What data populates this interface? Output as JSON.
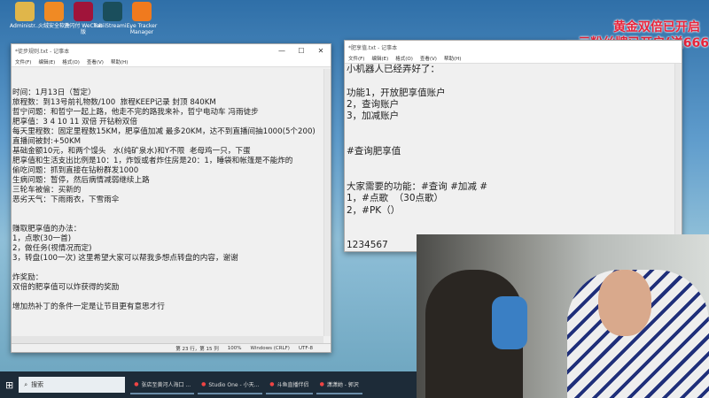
{
  "desktop_icons": [
    "Administr...",
    "火绒安全软件",
    "云闪付 WeChat版",
    "TobiiStreami...",
    "Eye Tracker Manager"
  ],
  "overlay": {
    "line1": "黄金双倍已开启",
    "line2": "一元粉丝牌已开启(送666"
  },
  "notepad1": {
    "title": "*徒步规则.txt - 记事本",
    "menu": [
      "文件(F)",
      "编辑(E)",
      "格式(O)",
      "查看(V)",
      "帮助(H)"
    ],
    "lines": [
      "",
      "",
      "时间：1月13日（暂定）",
      "旅程数：到13号前礼物数/100  旅程KEEP记录 封顶 840KM",
      "哲宁问题：和哲宁一起上路，他走不完的路我来补，哲宁电动车 冯雨徒步",
      "肥享值：3 4 10 11 双倍 开钻粉双倍",
      "每天里程数：固定里程数15KM，肥享值加减 最多20KM，达不到直播间抽1000(5个200)",
      "直播间被封:+50KM",
      "基础金额10元，和两个馒头   水(纯矿泉水)和Y不限  老母鸡一只，下蛋",
      "肥享值和生活支出比例是10：1，炸饭或者炸住房是20：1，睡袋和帐篷是不能炸的",
      "偷吃问题：抓到直接在钻粉群发1000",
      "生病问题：暂停，然后病情减弱继续上路",
      "三轮车被偷：买新的",
      "恶劣天气：下雨雨衣，下雪雨伞",
      "",
      "",
      "赚取肥享值的办法：",
      "1，点歌(30一首)",
      "2，做任务(视情况而定)",
      "3，转盘(100一次) 这里希望大家可以帮我多想点转盘的内容，谢谢",
      "",
      "炸奖励：",
      "双倍的肥享值可以炸获得的奖励",
      "",
      "增加热补丁的条件一定是让节目更有意思才行"
    ],
    "status": {
      "position": "第 23 行，第 15 列",
      "zoom": "100%",
      "eol": "Windows (CRLF)",
      "encoding": "UTF-8"
    }
  },
  "notepad2": {
    "title": "*肥享值.txt - 记事本",
    "menu": [
      "文件(F)",
      "编辑(E)",
      "格式(O)",
      "查看(V)",
      "帮助(H)"
    ],
    "lines": [
      "小机器人已经弄好了：",
      "",
      "功能1，开放肥享值账户",
      "2，查询账户",
      "3，加减账户",
      "",
      "",
      "#查询肥享值",
      "",
      "",
      "大家需要的功能：#查询 #加减 #",
      "1，#点歌  （30点歌）",
      "2，#PK（）",
      "",
      "",
      "1234567"
    ]
  },
  "taskbar": {
    "search": "搜索",
    "items": [
      "张店至黄河人海口 ...",
      "Studio One - 小天...",
      "斗鱼直播伴侣",
      "潇潇她 - 郭沢"
    ]
  }
}
